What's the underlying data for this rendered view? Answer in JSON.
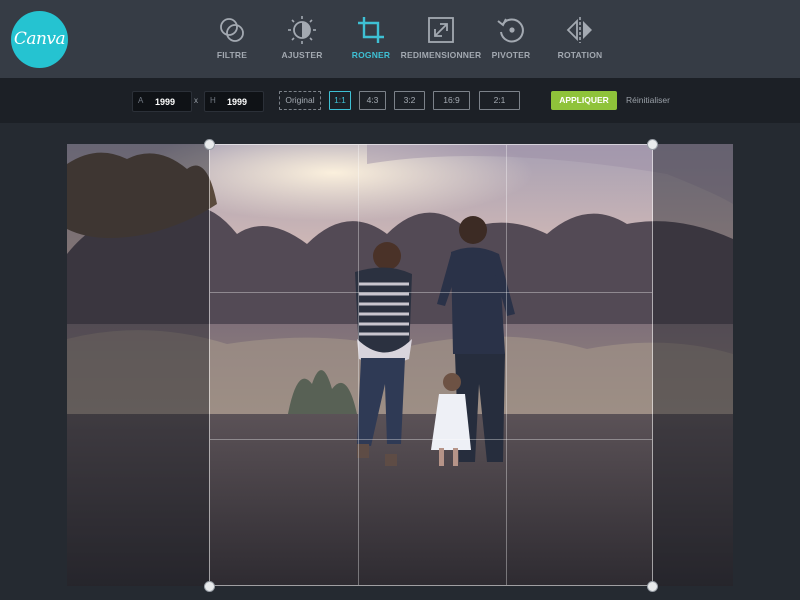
{
  "app": {
    "logo_text": "Canva",
    "brand_color": "#25c3d1"
  },
  "toolbar": {
    "tools": [
      {
        "label": "FILTRE",
        "icon": "filter-icon"
      },
      {
        "label": "AJUSTER",
        "icon": "adjust-icon"
      },
      {
        "label": "ROGNER",
        "icon": "crop-icon",
        "active": true
      },
      {
        "label": "REDIMENSIONNER",
        "icon": "resize-icon"
      },
      {
        "label": "PIVOTER",
        "icon": "rotate-icon"
      },
      {
        "label": "ROTATION",
        "icon": "flip-icon"
      }
    ],
    "active_color": "#3ec0d4"
  },
  "crop": {
    "width_label": "A",
    "width_value": "1999",
    "times": "x",
    "height_label": "H",
    "height_value": "1999",
    "ratios": [
      "Original",
      "1:1",
      "4:3",
      "3:2",
      "16:9",
      "2:1"
    ],
    "selected_ratio": "1:1",
    "apply_label": "APPLIQUER",
    "apply_color": "#8fc33a",
    "reset_label": "Réinitialiser"
  }
}
